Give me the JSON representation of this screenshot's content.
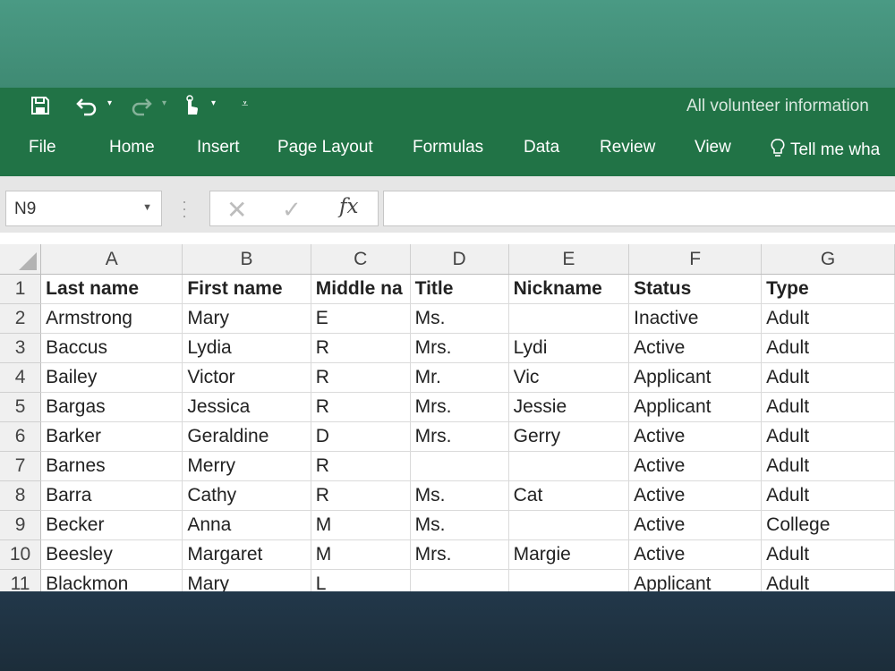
{
  "window": {
    "title": "All volunteer information"
  },
  "quick_access": {
    "icons": [
      "save-icon",
      "undo-icon",
      "redo-icon",
      "touch-mode-icon",
      "customize-icon"
    ]
  },
  "ribbon": {
    "tabs": [
      "File",
      "Home",
      "Insert",
      "Page Layout",
      "Formulas",
      "Data",
      "Review",
      "View"
    ],
    "tell_me": "Tell me wha"
  },
  "formula_bar": {
    "name_box": "N9",
    "fx_label": "fx",
    "formula": ""
  },
  "sheet": {
    "columns": [
      "A",
      "B",
      "C",
      "D",
      "E",
      "F",
      "G"
    ],
    "rows": [
      {
        "num": "1",
        "cells": [
          "Last name",
          "First name",
          "Middle na",
          "Title",
          "Nickname",
          "Status",
          "Type"
        ]
      },
      {
        "num": "2",
        "cells": [
          "Armstrong",
          "Mary",
          "E",
          "Ms.",
          "",
          "Inactive",
          "Adult"
        ]
      },
      {
        "num": "3",
        "cells": [
          "Baccus",
          "Lydia",
          "R",
          "Mrs.",
          "Lydi",
          "Active",
          "Adult"
        ]
      },
      {
        "num": "4",
        "cells": [
          "Bailey",
          "Victor",
          "R",
          "Mr.",
          "Vic",
          "Applicant",
          "Adult"
        ]
      },
      {
        "num": "5",
        "cells": [
          "Bargas",
          "Jessica",
          "R",
          "Mrs.",
          "Jessie",
          "Applicant",
          "Adult"
        ]
      },
      {
        "num": "6",
        "cells": [
          "Barker",
          "Geraldine",
          "D",
          "Mrs.",
          "Gerry",
          "Active",
          "Adult"
        ]
      },
      {
        "num": "7",
        "cells": [
          "Barnes",
          "Merry",
          "R",
          "",
          "",
          "Active",
          "Adult"
        ]
      },
      {
        "num": "8",
        "cells": [
          "Barra",
          "Cathy",
          "R",
          "Ms.",
          "Cat",
          "Active",
          "Adult"
        ]
      },
      {
        "num": "9",
        "cells": [
          "Becker",
          "Anna",
          "M",
          "Ms.",
          "",
          "Active",
          "College"
        ]
      },
      {
        "num": "10",
        "cells": [
          "Beesley",
          "Margaret",
          "M",
          "Mrs.",
          "Margie",
          "Active",
          "Adult"
        ]
      },
      {
        "num": "11",
        "cells": [
          "Blackmon",
          "Mary",
          "L",
          "",
          "",
          "Applicant",
          "Adult"
        ]
      }
    ]
  }
}
